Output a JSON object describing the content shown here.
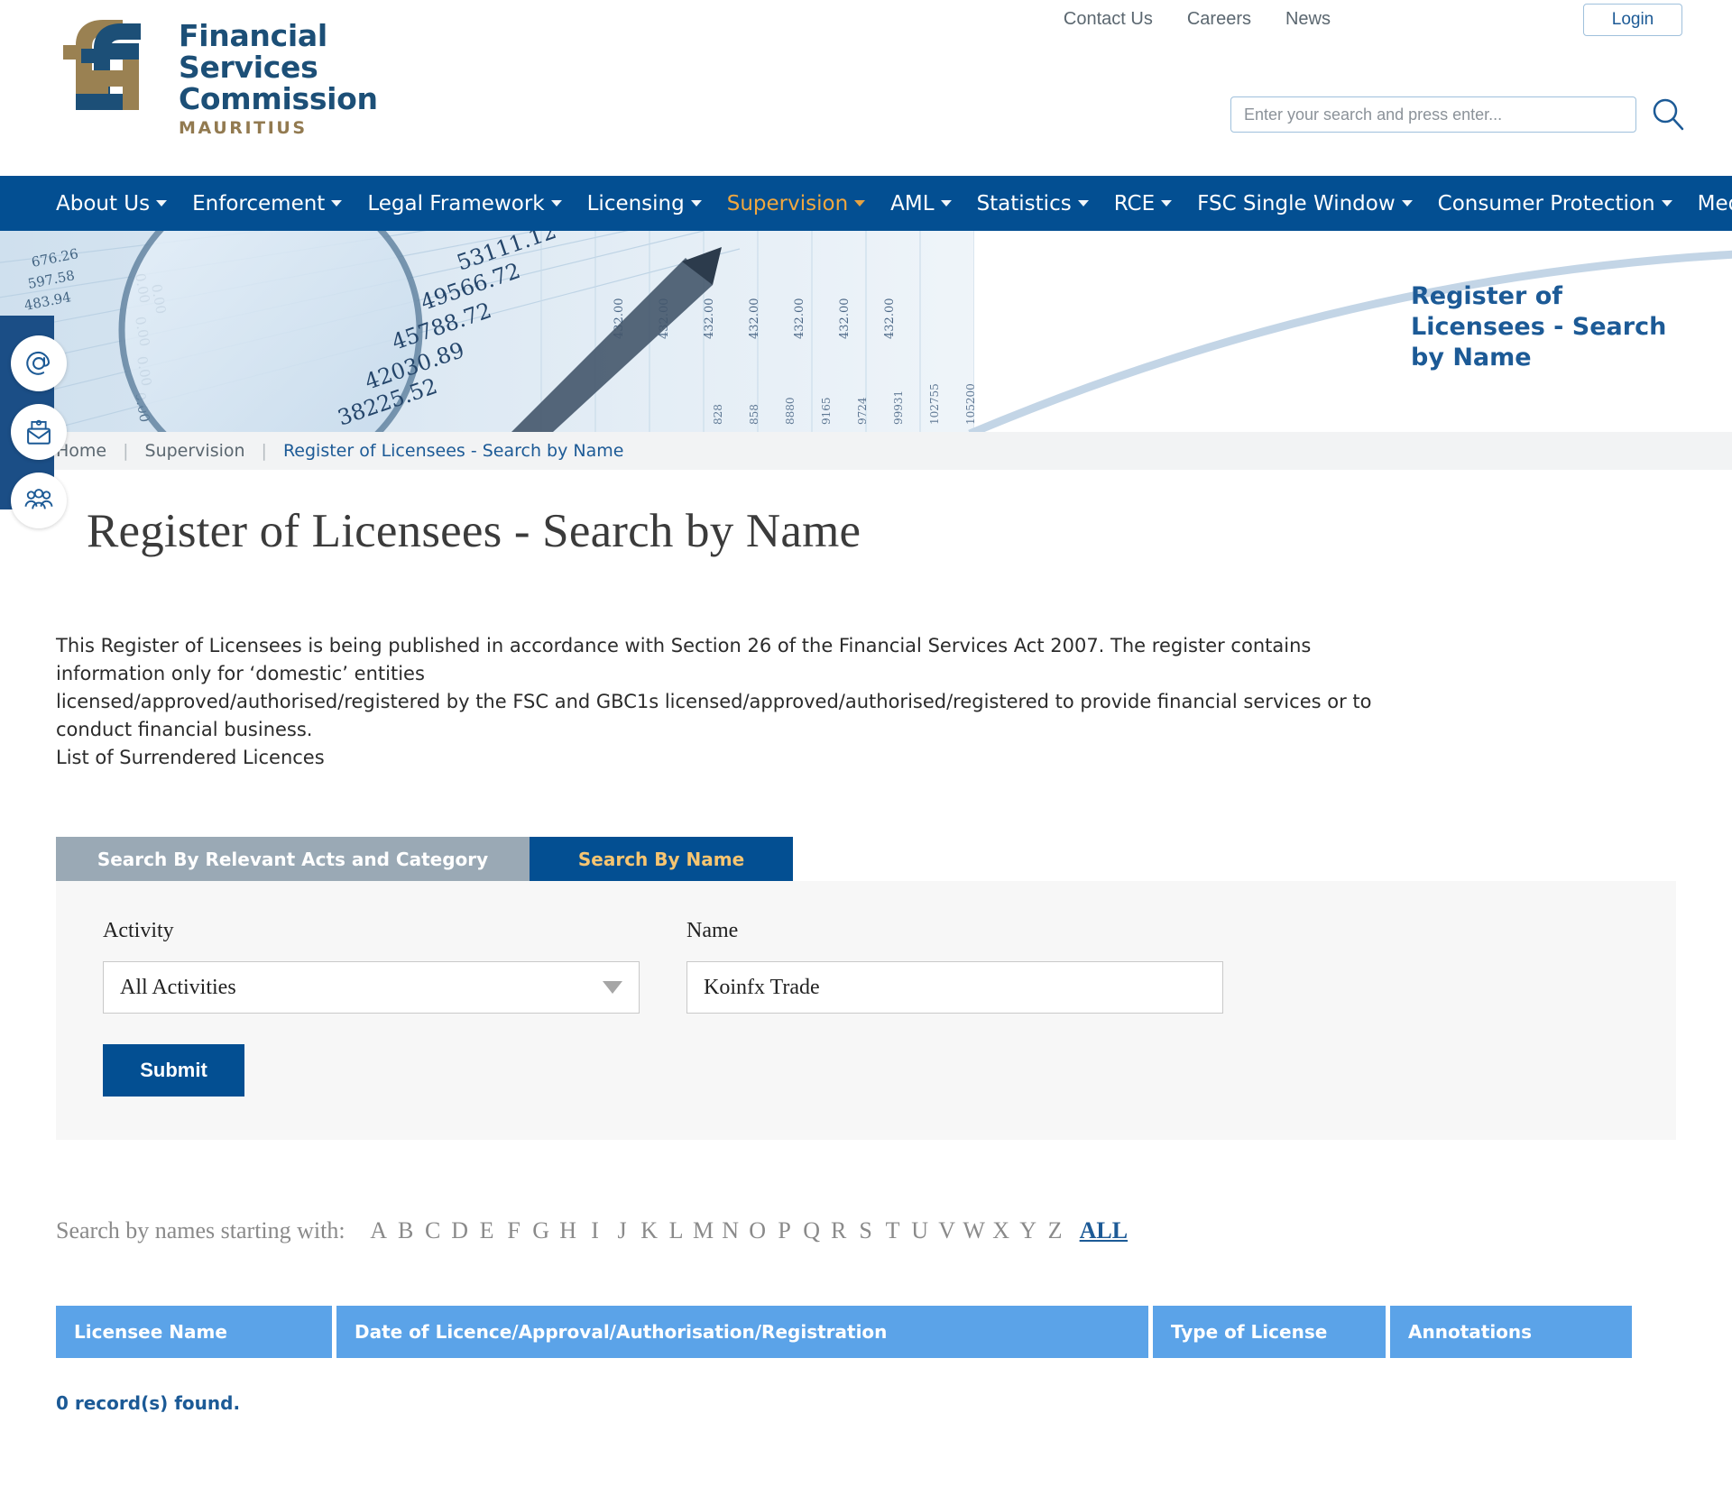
{
  "brand": {
    "line1": "Financial",
    "line2": "Services",
    "line3": "Commission",
    "country": "MAURITIUS",
    "logo_gold": "#927a50",
    "logo_blue": "#1c4f77"
  },
  "header": {
    "util_links": [
      {
        "label": "Contact Us",
        "name": "contact-us-link"
      },
      {
        "label": "Careers",
        "name": "careers-link"
      },
      {
        "label": "News",
        "name": "news-link"
      }
    ],
    "login_label": "Login",
    "search_placeholder": "Enter your search and press enter...",
    "search_value": "",
    "search_icon": "search-icon"
  },
  "nav": {
    "accent_color": "#f0a73f",
    "bg_color": "#034f92",
    "items": [
      {
        "label": "About Us",
        "caret": true,
        "active": false
      },
      {
        "label": "Enforcement",
        "caret": true,
        "active": false
      },
      {
        "label": "Legal Framework",
        "caret": true,
        "active": false
      },
      {
        "label": "Licensing",
        "caret": true,
        "active": false
      },
      {
        "label": "Supervision",
        "caret": true,
        "active": true
      },
      {
        "label": "AML",
        "caret": true,
        "active": false
      },
      {
        "label": "Statistics",
        "caret": true,
        "active": false
      },
      {
        "label": "RCE",
        "caret": true,
        "active": false
      },
      {
        "label": "FSC Single Window",
        "caret": true,
        "active": false
      },
      {
        "label": "Consumer Protection",
        "caret": true,
        "active": false
      },
      {
        "label": "Media Corner",
        "caret": true,
        "active": false
      }
    ]
  },
  "hero": {
    "title": "Register of Licensees - Search by Name",
    "title_color": "#1c5a96"
  },
  "side_rail": {
    "icons": [
      {
        "name": "at-sign-icon"
      },
      {
        "name": "envelope-icon"
      },
      {
        "name": "people-group-icon"
      }
    ]
  },
  "breadcrumb": {
    "home": "Home",
    "section": "Supervision",
    "current": "Register of Licensees - Search by Name",
    "separator": "|"
  },
  "page": {
    "title": "Register of Licensees - Search by Name",
    "intro_line1": "This Register of Licensees is being published in accordance with Section 26 of the Financial Services Act 2007. The register contains information only for ‘domestic’ entities",
    "intro_line2": "licensed/approved/authorised/registered by the FSC and GBC1s licensed/approved/authorised/registered to provide financial services or to conduct financial business.",
    "intro_line3": "List of Surrendered Licences"
  },
  "tabs": [
    {
      "label": "Search By Relevant Acts and Category",
      "active": false,
      "name": "tab-search-by-acts"
    },
    {
      "label": "Search By Name",
      "active": true,
      "name": "tab-search-by-name"
    }
  ],
  "form": {
    "activity_label": "Activity",
    "activity_value": "All Activities",
    "activity_options": [
      "All Activities"
    ],
    "name_label": "Name",
    "name_value": "Koinfx Trade",
    "name_placeholder": "",
    "submit_label": "Submit"
  },
  "alphabet": {
    "label": "Search by names starting with:",
    "letters": [
      "A",
      "B",
      "C",
      "D",
      "E",
      "F",
      "G",
      "H",
      "I",
      "J",
      "K",
      "L",
      "M",
      "N",
      "O",
      "P",
      "Q",
      "R",
      "S",
      "T",
      "U",
      "V",
      "W",
      "X",
      "Y",
      "Z"
    ],
    "all_label": "ALL"
  },
  "table": {
    "header_color": "#5ba3e8",
    "columns": [
      {
        "label": "Licensee Name"
      },
      {
        "label": "Date of Licence/Approval/Authorisation/Registration"
      },
      {
        "label": "Type of License"
      },
      {
        "label": "Annotations"
      }
    ],
    "rows": [],
    "record_count_text": "0 record(s) found."
  }
}
